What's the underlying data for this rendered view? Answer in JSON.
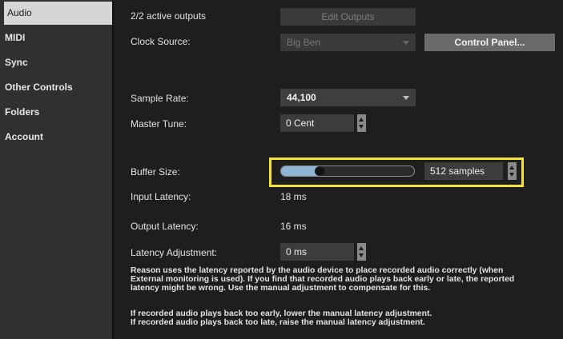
{
  "sidebar": {
    "items": [
      {
        "label": "Audio",
        "active": true
      },
      {
        "label": "MIDI"
      },
      {
        "label": "Sync"
      },
      {
        "label": "Other Controls"
      },
      {
        "label": "Folders"
      },
      {
        "label": "Account"
      }
    ]
  },
  "outputs": {
    "status": "2/2 active outputs",
    "edit_button": "Edit Outputs"
  },
  "clock": {
    "label": "Clock Source:",
    "value": "Big Ben",
    "control_panel_button": "Control Panel..."
  },
  "sample_rate": {
    "label": "Sample Rate:",
    "value": "44,100"
  },
  "master_tune": {
    "label": "Master Tune:",
    "value": "0 Cent"
  },
  "buffer": {
    "label": "Buffer Size:",
    "value": "512 samples",
    "slider_fraction": 0.29
  },
  "input_latency": {
    "label": "Input Latency:",
    "value": "18 ms"
  },
  "output_latency": {
    "label": "Output Latency:",
    "value": "16 ms"
  },
  "latency_adjustment": {
    "label": "Latency Adjustment:",
    "value": "0 ms"
  },
  "help": {
    "line1": "Reason uses the latency reported by the audio device to place recorded audio correctly (when",
    "line2": "External monitoring is used). If you find that recorded audio plays back early or late, the reported",
    "line3": "latency might be wrong. Use the manual adjustment to compensate for this.",
    "line4": "If recorded audio plays back too early, lower the manual latency adjustment.",
    "line5": "If recorded audio plays back too late, raise the manual latency adjustment."
  },
  "colors": {
    "highlight": "#f3e33a",
    "slider_fill": "#8fb4d4"
  }
}
